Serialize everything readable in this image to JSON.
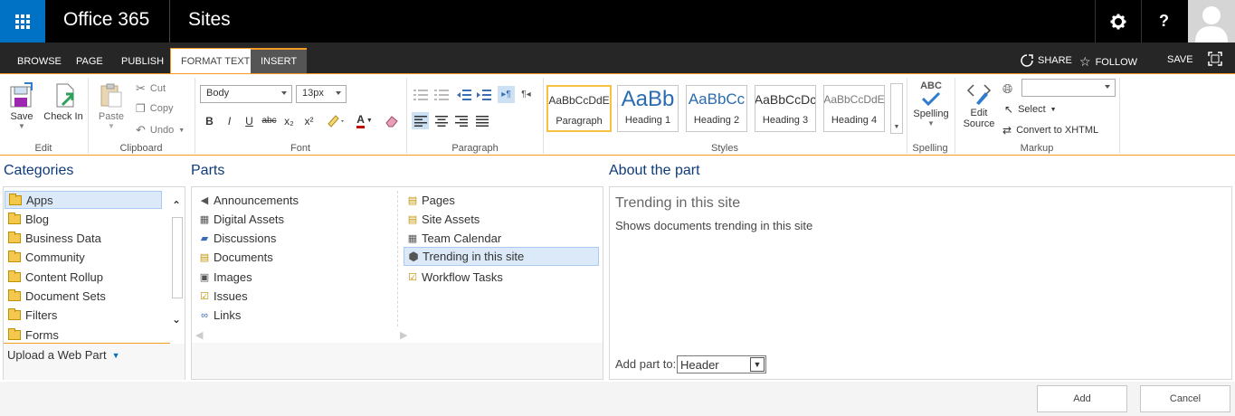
{
  "suite": {
    "brand": "Office 365",
    "app_title": "Sites",
    "help": "?"
  },
  "tabs": [
    {
      "label": "BROWSE"
    },
    {
      "label": "PAGE"
    },
    {
      "label": "PUBLISH"
    },
    {
      "label": "FORMAT TEXT"
    },
    {
      "label": "INSERT"
    }
  ],
  "actions": {
    "share": "SHARE",
    "follow": "FOLLOW",
    "save": "SAVE"
  },
  "ribbon": {
    "edit": {
      "label": "Edit",
      "save": "Save",
      "checkin": "Check In"
    },
    "clipboard": {
      "label": "Clipboard",
      "paste": "Paste",
      "cut": "Cut",
      "copy": "Copy",
      "undo": "Undo"
    },
    "font": {
      "label": "Font",
      "family": "Body",
      "size": "13px",
      "bold": "B",
      "italic": "I",
      "underline": "U",
      "strike": "abc",
      "sub": "x₂",
      "sup": "x²",
      "color_a": "A"
    },
    "paragraph": {
      "label": "Paragraph"
    },
    "styles": {
      "label": "Styles",
      "items": [
        {
          "preview": "AaBbCcDdE",
          "name": "Paragraph"
        },
        {
          "preview": "AaBb",
          "name": "Heading 1"
        },
        {
          "preview": "AaBbCc",
          "name": "Heading 2"
        },
        {
          "preview": "AaBbCcDc",
          "name": "Heading 3"
        },
        {
          "preview": "AaBbCcDdE",
          "name": "Heading 4"
        }
      ]
    },
    "spelling": {
      "label": "Spelling",
      "abc": "ABC",
      "button": "Spelling"
    },
    "markup": {
      "label": "Markup",
      "edit_source_1": "Edit",
      "edit_source_2": "Source",
      "select": "Select",
      "convert": "Convert to XHTML",
      "language_value": ""
    }
  },
  "categories": {
    "title": "Categories",
    "items": [
      "Apps",
      "Blog",
      "Business Data",
      "Community",
      "Content Rollup",
      "Document Sets",
      "Filters",
      "Forms"
    ],
    "upload": "Upload a Web Part"
  },
  "parts": {
    "title": "Parts",
    "left": [
      "Announcements",
      "Digital Assets",
      "Discussions",
      "Documents",
      "Images",
      "Issues",
      "Links"
    ],
    "right": [
      "Pages",
      "Site Assets",
      "Team Calendar",
      "Trending in this site",
      "Workflow Tasks"
    ]
  },
  "about": {
    "title": "About the part",
    "part_name": "Trending in this site",
    "description": "Shows documents trending in this site",
    "add_label": "Add part to:",
    "add_value": "Header"
  },
  "buttons": {
    "add": "Add",
    "cancel": "Cancel"
  }
}
